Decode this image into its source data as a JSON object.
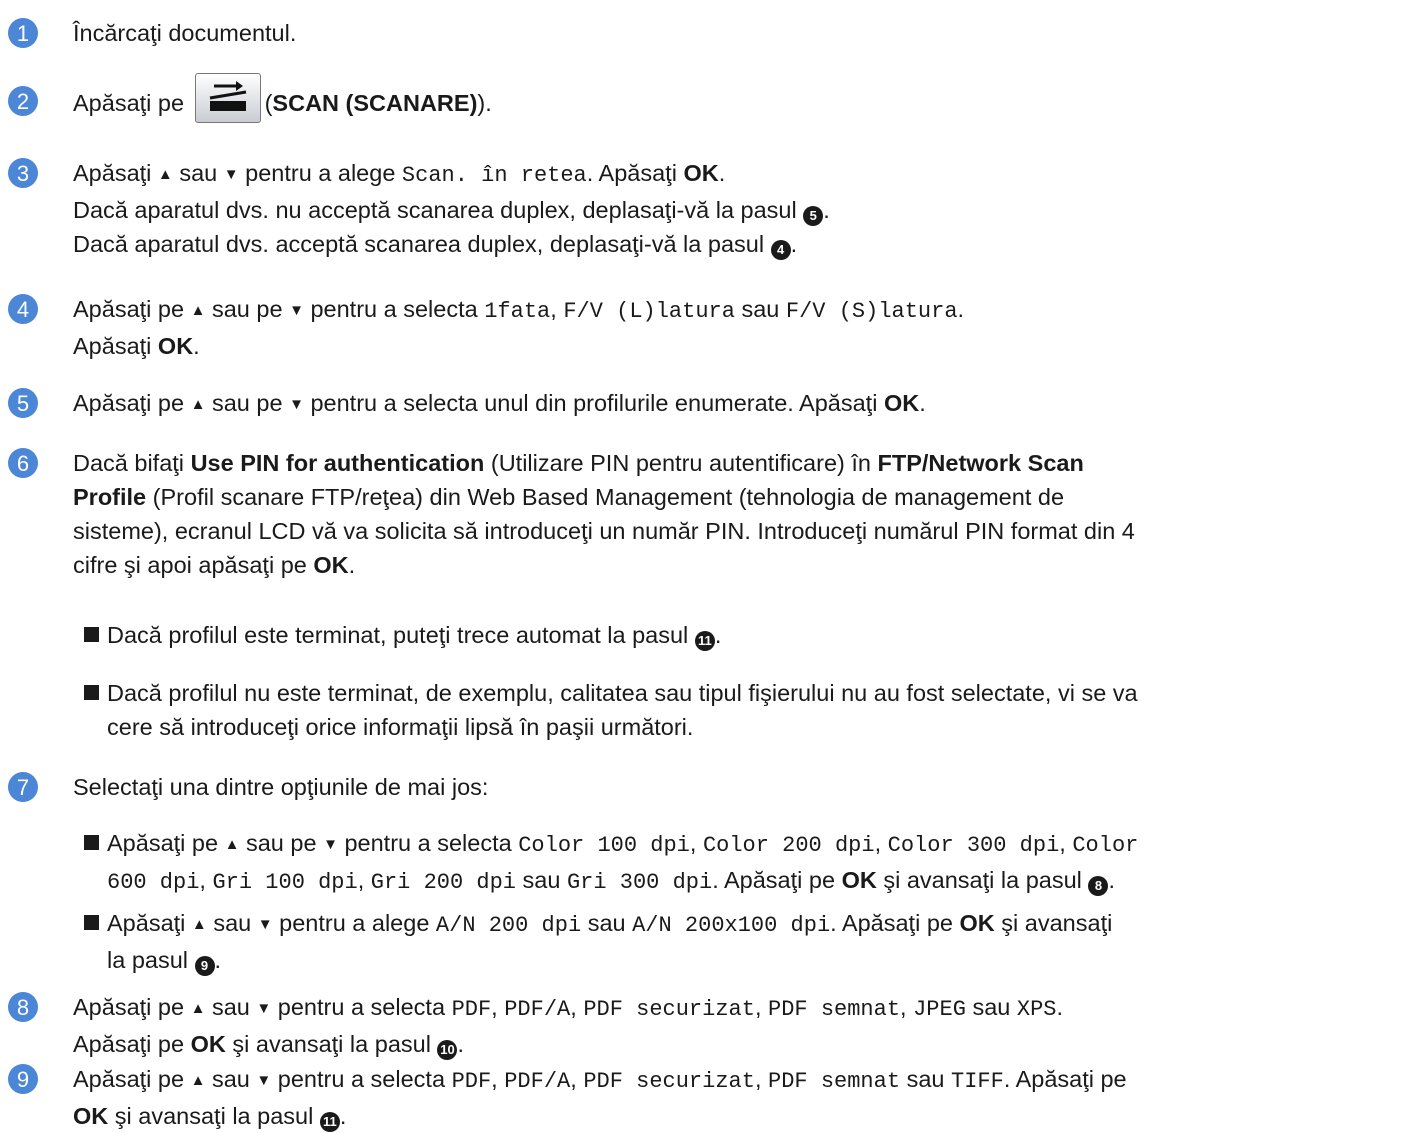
{
  "steps": [
    {
      "n": "1",
      "text": "Încărcaţi documentul."
    },
    {
      "n": "2",
      "pre": "Apăsaţi pe",
      "post_open": "(",
      "post_bold": "SCAN (SCANARE)",
      "post_close": ")."
    },
    {
      "n": "3",
      "l1_a": "Apăsaţi",
      "l1_b": "sau",
      "l1_c": "pentru a alege",
      "l1_mono": "Scan. în retea",
      "l1_d": ". Apăsaţi",
      "l1_ok": "OK",
      "l1_e": ".",
      "l2": "Dacă aparatul dvs. nu acceptă scanarea duplex, deplasaţi-vă la pasul",
      "l2_ref": "5",
      "l3": "Dacă aparatul dvs. acceptă scanarea duplex, deplasaţi-vă la pasul",
      "l3_ref": "4"
    },
    {
      "n": "4",
      "a": "Apăsaţi pe",
      "b": "sau pe",
      "c": "pentru a selecta",
      "m1": "1fata",
      "m2": "F/V (L)latura",
      "sau": "sau",
      "m3": "F/V (S)latura",
      "l2": "Apăsaţi",
      "ok": "OK"
    },
    {
      "n": "5",
      "a": "Apăsaţi pe",
      "b": "sau pe",
      "c": "pentru a selecta unul din profilurile enumerate. Apăsaţi",
      "ok": "OK"
    },
    {
      "n": "6",
      "p1": "Dacă bifaţi",
      "b1": "Use PIN for authentication",
      "p2": "(Utilizare PIN pentru autentificare) în",
      "b2": "FTP/Network Scan",
      "b3": "Profile",
      "p3": "(Profil scanare FTP/reţea) din Web Based Management (tehnologia de management de",
      "p4": "sisteme), ecranul LCD vă va solicita să introduceţi un număr PIN. Introduceţi numărul PIN format din 4",
      "p5": "cifre şi apoi apăsaţi pe",
      "ok": "OK",
      "bullet1": "Dacă profilul este terminat, puteţi trece automat la pasul",
      "bullet1_ref": "11",
      "bullet2_l1": "Dacă profilul nu este terminat, de exemplu, calitatea sau tipul fişierului nu au fost selectate, vi se va",
      "bullet2_l2": "cere să introduceţi orice informaţii lipsă în paşii următori."
    },
    {
      "n": "7",
      "text": "Selectaţi una dintre opţiunile de mai jos:",
      "b1_a": "Apăsaţi pe",
      "b1_b": "sau pe",
      "b1_c": "pentru a selecta",
      "b1_m1": "Color 100 dpi",
      "b1_m2": "Color 200 dpi",
      "b1_m3": "Color 300 dpi",
      "b1_m4a": "Color",
      "b1_m4b": "600 dpi",
      "b1_m5": "Gri 100 dpi",
      "b1_m6": "Gri 200 dpi",
      "b1_sau": "sau",
      "b1_m7": "Gri 300 dpi",
      "b1_d": ". Apăsaţi pe",
      "b1_ok": "OK",
      "b1_e": "şi avansaţi la pasul",
      "b1_ref": "8",
      "b2_a": "Apăsaţi",
      "b2_b": "sau",
      "b2_c": "pentru a alege",
      "b2_m1": "A/N 200 dpi",
      "b2_sau": "sau",
      "b2_m2": "A/N 200x100 dpi",
      "b2_d": ". Apăsaţi pe",
      "b2_ok": "OK",
      "b2_e": "şi avansaţi",
      "b2_l2": "la pasul",
      "b2_ref": "9"
    },
    {
      "n": "8",
      "a": "Apăsaţi pe",
      "b": "sau",
      "c": "pentru a selecta",
      "m1": "PDF",
      "m2": "PDF/A",
      "m3": "PDF securizat",
      "m4": "PDF semnat",
      "m5": "JPEG",
      "sau": "sau",
      "m6": "XPS",
      "l2": "Apăsaţi pe",
      "ok": "OK",
      "l2b": "şi avansaţi la pasul",
      "ref": "10"
    },
    {
      "n": "9",
      "a": "Apăsaţi pe",
      "b": "sau",
      "c": "pentru a selecta",
      "m1": "PDF",
      "m2": "PDF/A",
      "m3": "PDF securizat",
      "m4": "PDF semnat",
      "sau": "sau",
      "m5": "TIFF",
      "d": ". Apăsaţi pe",
      "ok": "OK",
      "l2b": "şi avansaţi la pasul",
      "ref": "11"
    }
  ],
  "colors": {
    "step_badge": "#4c86d6",
    "text": "#1a1a1a"
  },
  "icons": {
    "up": "▲",
    "down": "▼",
    "scan": "scan-button-icon"
  }
}
